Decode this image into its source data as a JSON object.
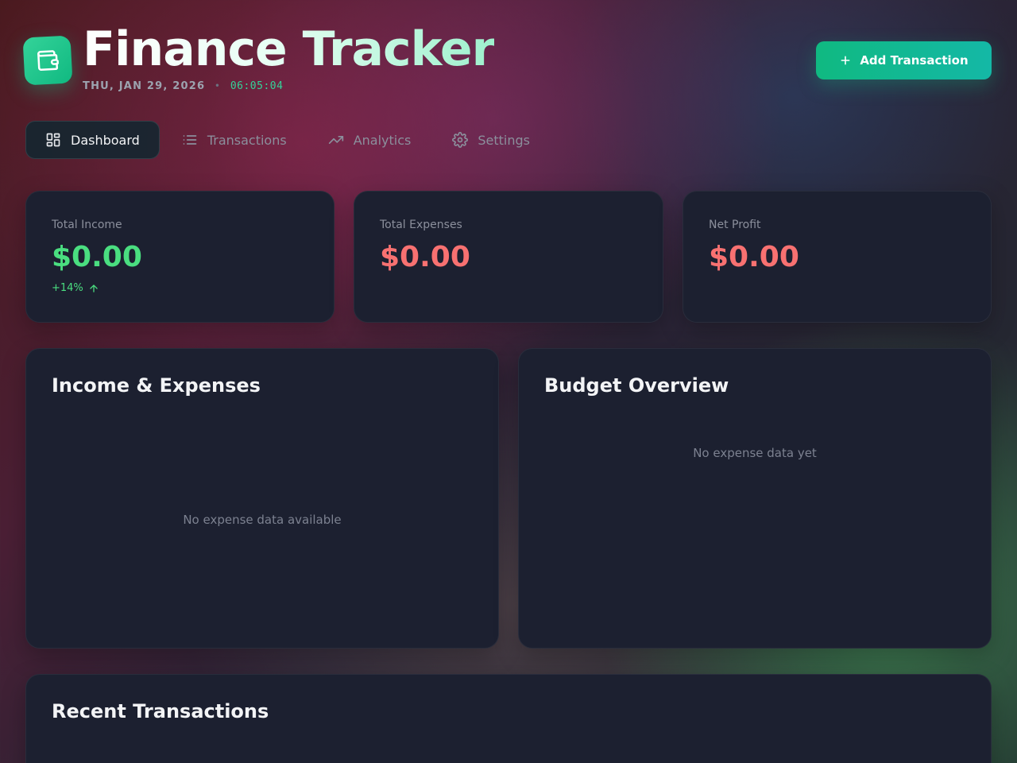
{
  "header": {
    "title": "Finance Tracker",
    "date": "THU, JAN 29, 2026",
    "separator": "•",
    "time": "06:05:04",
    "logo_icon": "wallet-icon",
    "add_button_label": "Add Transaction",
    "add_button_icon": "plus-icon"
  },
  "nav": {
    "tabs": [
      {
        "label": "Dashboard",
        "icon": "grid-icon",
        "active": true
      },
      {
        "label": "Transactions",
        "icon": "list-icon",
        "active": false
      },
      {
        "label": "Analytics",
        "icon": "trending-up-icon",
        "active": false
      },
      {
        "label": "Settings",
        "icon": "gear-icon",
        "active": false
      }
    ]
  },
  "stats": [
    {
      "label": "Total Income",
      "value": "$0.00",
      "trend": "+14%",
      "color": "#4ade80"
    },
    {
      "label": "Total Expenses",
      "value": "$0.00",
      "color": "#f87171"
    },
    {
      "label": "Net Profit",
      "value": "$0.00",
      "color": "#f87171"
    }
  ],
  "panels": {
    "income_expenses": {
      "title": "Income & Expenses",
      "empty": "No expense data available"
    },
    "budget": {
      "title": "Budget Overview",
      "empty": "No expense data yet"
    },
    "recent": {
      "title": "Recent Transactions"
    }
  },
  "colors": {
    "accent": "#10b981",
    "income": "#4ade80",
    "expense": "#f87171",
    "card_bg": "#1c2030"
  }
}
